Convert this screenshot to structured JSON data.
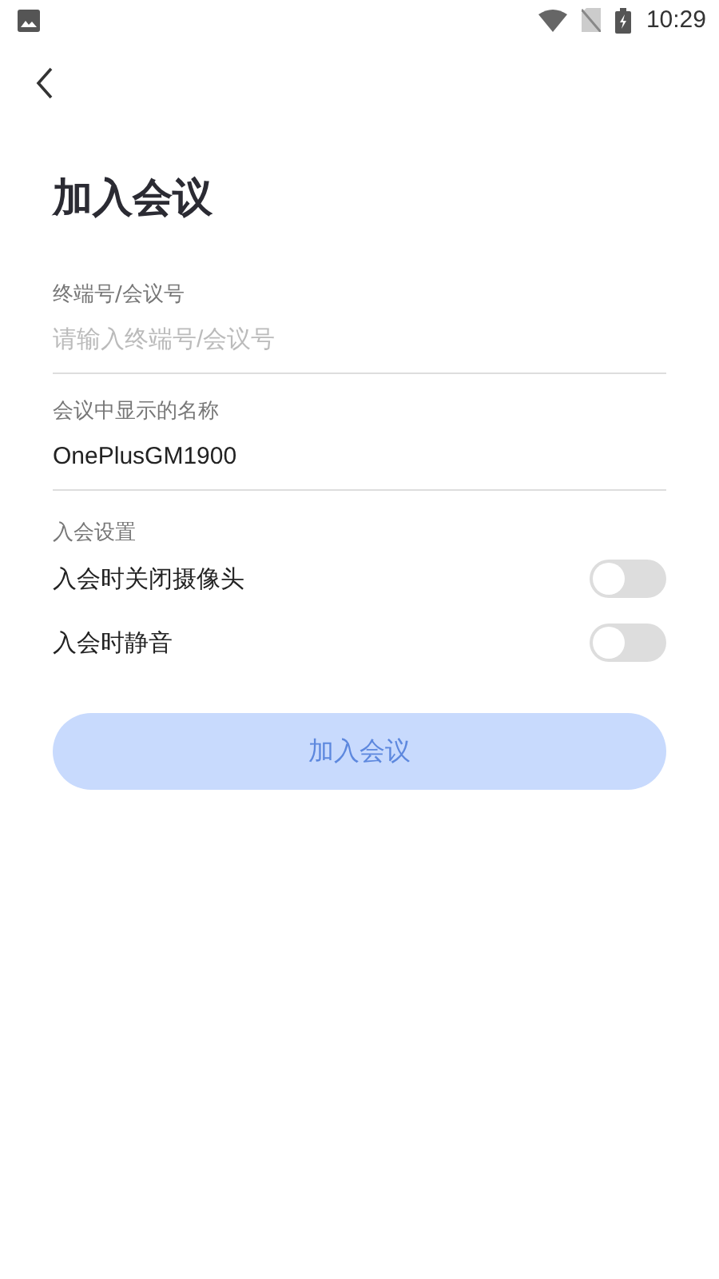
{
  "status_bar": {
    "time": "10:29"
  },
  "title": "加入会议",
  "fields": [
    {
      "label": "终端号/会议号",
      "placeholder": "请输入终端号/会议号"
    },
    {
      "label": "会议中显示的名称",
      "value": "OnePlusGM1900"
    }
  ],
  "settings": {
    "heading": "入会设置",
    "items": [
      {
        "label": "入会时关闭摄像头",
        "on": false
      },
      {
        "label": "入会时静音",
        "on": false
      }
    ]
  },
  "join_button": {
    "label": "加入会议",
    "disabled": true
  }
}
